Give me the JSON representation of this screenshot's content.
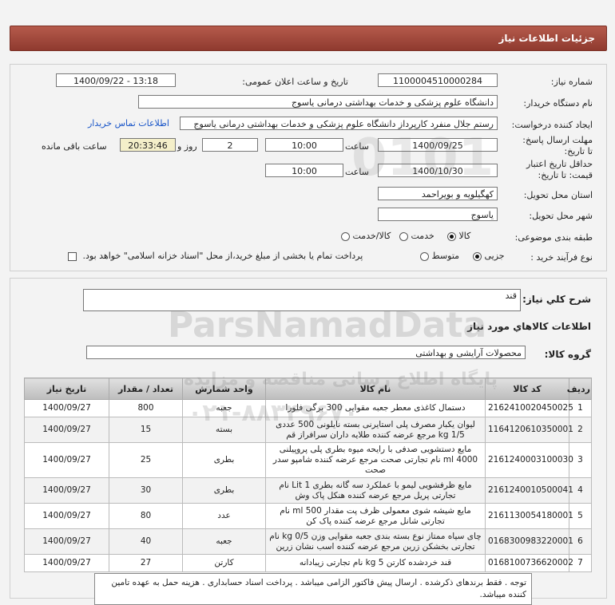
{
  "header": {
    "title": "جزئیات اطلاعات نیاز"
  },
  "form": {
    "need_number_label": "شماره نیاز:",
    "need_number": "1100004510000284",
    "announce_label": "تاریخ و ساعت اعلان عمومی:",
    "announce_value": "1400/09/22 - 13:18",
    "buyer_org_label": "نام دستگاه خریدار:",
    "buyer_org": "دانشگاه علوم پزشکی و خدمات بهداشتی  درمانی یاسوج",
    "creator_label": "ایجاد کننده درخواست:",
    "creator": "رستم جلال منفرد کارپرداز دانشگاه علوم پزشکی و خدمات بهداشتی  درمانی یاسوج",
    "contact_link": "اطلاعات تماس خریدار",
    "reply_deadline_label": "مهلت ارسال پاسخ: تا تاریخ:",
    "reply_date": "1400/09/25",
    "time_label": "ساعت",
    "reply_time": "10:00",
    "days_count": "2",
    "days_and": "روز و",
    "remaining_time": "20:33:46",
    "remaining_label": "ساعت باقی مانده",
    "validity_label": "حداقل تاریخ اعتبار قیمت: تا تاریخ:",
    "validity_date": "1400/10/30",
    "validity_time_label": "ساعت",
    "validity_time": "10:00",
    "province_label": "استان محل تحویل:",
    "province": "کهگیلویه و بویراحمد",
    "city_label": "شهر محل تحویل:",
    "city": "یاسوج",
    "category_label": "طبقه بندی موضوعی:",
    "category_options": [
      "کالا",
      "خدمت",
      "کالا/خدمت"
    ],
    "process_label": "نوع فرآیند خرید :",
    "process_options": [
      "جزیی",
      "متوسط"
    ],
    "payment_note": "پرداخت تمام یا بخشی از مبلغ خرید،از محل \"اسناد خزانه اسلامی\" خواهد بود."
  },
  "details": {
    "summary_label": "شرح کلي نياز:",
    "summary_value": "قند",
    "goods_info_title": "اطلاعات کالاهاي مورد نياز",
    "goods_group_label": "گروه کالا:",
    "goods_group_value": "محصولات آرایشی و بهداشتی"
  },
  "table": {
    "headers": [
      "ردیف",
      "کد کالا",
      "نام کالا",
      "واحد شمارش",
      "تعداد / مقدار",
      "تاریخ نیاز"
    ],
    "rows": [
      [
        "1",
        "2162410020450025",
        "دستمال کاغذی معطر جعبه مقوایی 300 برگی فلورا",
        "جعبه",
        "800",
        "1400/09/27"
      ],
      [
        "2",
        "1164120610350001",
        "لیوان یکبار مصرف پلی استایرنی بسته نایلونی 500 عددی 1/5 kg مرجع عرضه کننده طلایه داران سرافراز قم",
        "بسته",
        "15",
        "1400/09/27"
      ],
      [
        "3",
        "2161240003100030",
        "مایع دستشویی صدفی با رایحه میوه بطری پلی پروپیلنی 4000 ml نام تجارتی صحت مرجع عرضه کننده شامپو سدر صحت",
        "بطری",
        "25",
        "1400/09/27"
      ],
      [
        "4",
        "2161240010500041",
        "مایع ظرفشویی لیمو با عملکرد سه گانه بطری 1 Lit نام تجارتی پریل مرجع عرضه کننده هنکل پاک وش",
        "بطری",
        "30",
        "1400/09/27"
      ],
      [
        "5",
        "2161130054180001",
        "مایع شیشه شوی معمولی ظرف پت مقدار 500 ml نام تجارتی شانل مرجع عرضه کننده پاک کن",
        "عدد",
        "80",
        "1400/09/27"
      ],
      [
        "6",
        "0168300983220001",
        "چای سیاه ممتاز نوع بسته بندی جعبه مقوایی وزن 0/5 kg نام تجارتی بخشکن زرین مرجع عرضه کننده اسب نشان زرین",
        "جعبه",
        "40",
        "1400/09/27"
      ],
      [
        "7",
        "0168100736620002",
        "قند خردشده کارتن 5 kg نام تجارتی زیبادانه",
        "کارتن",
        "27",
        "1400/09/27"
      ]
    ]
  },
  "note": {
    "text": "توجه . فقط برندهای ذکرشده . ارسال پیش فاکتور الزامی میباشد . پرداخت اسناد حسابداری . هزینه حمل به عهده تامین کننده میباشد."
  },
  "watermark": {
    "brand": "ParsNamadData",
    "tagline": "پایگاه اطلاع رسانی مناقصه و مزایده",
    "phone": "۰۲۱-۸۸۳۴۹۶۷۰",
    "digits": "0101"
  }
}
